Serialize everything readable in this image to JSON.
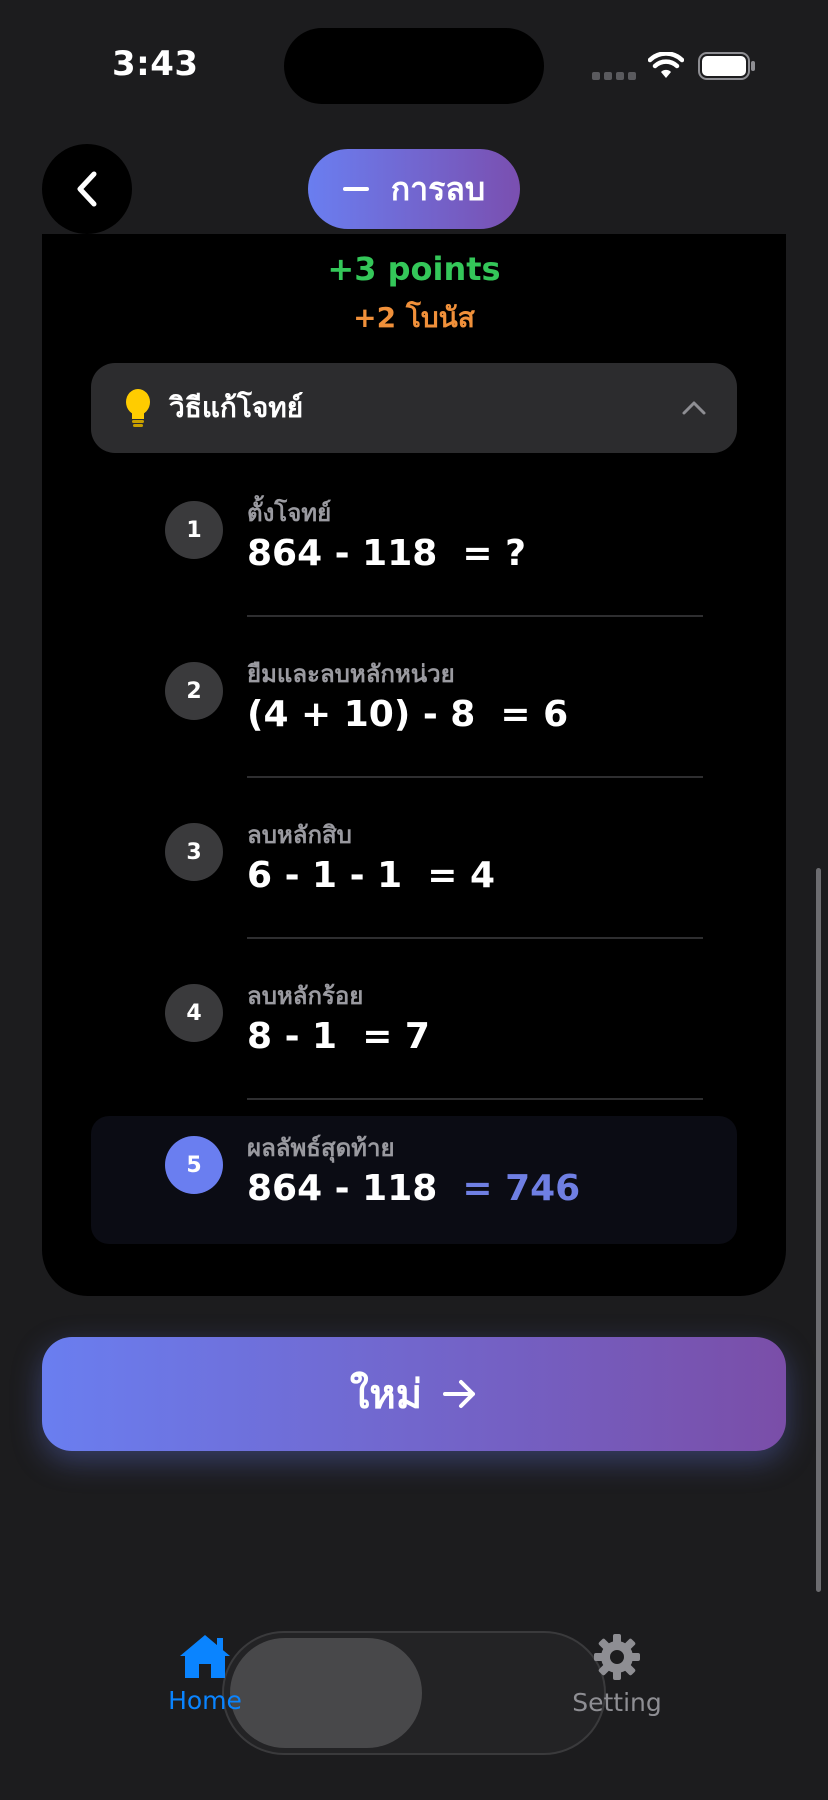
{
  "status": {
    "time": "3:43"
  },
  "header": {
    "operation_label": "การลบ"
  },
  "card": {
    "points": "+3 points",
    "bonus": "+2 โบนัส",
    "hint_title": "วิธีแก้โจทย์",
    "steps": [
      {
        "number": "1",
        "label": "ตั้งโจทย์",
        "expression": "864 - 118",
        "equals": "= ?"
      },
      {
        "number": "2",
        "label": "ยืมและลบหลักหน่วย",
        "expression": "(4 + 10) - 8",
        "equals": "= 6"
      },
      {
        "number": "3",
        "label": "ลบหลักสิบ",
        "expression": "6 - 1 - 1",
        "equals": "= 4"
      },
      {
        "number": "4",
        "label": "ลบหลักร้อย",
        "expression": "8 - 1",
        "equals": "= 7"
      },
      {
        "number": "5",
        "label": "ผลลัพธ์สุดท้าย",
        "expression": "864 - 118",
        "equals": "= 746"
      }
    ]
  },
  "new_button": {
    "label": "ใหม่"
  },
  "tabbar": {
    "items": [
      {
        "label": "Home",
        "icon": "house-icon"
      },
      {
        "label": "Setting",
        "icon": "gear-icon"
      }
    ]
  },
  "colors": {
    "accent_gradient_start": "#6a7ef0",
    "accent_gradient_end": "#7a4fb0",
    "points_green": "#34c759",
    "bonus_orange": "#f0903a",
    "tab_active": "#0a84ff"
  }
}
